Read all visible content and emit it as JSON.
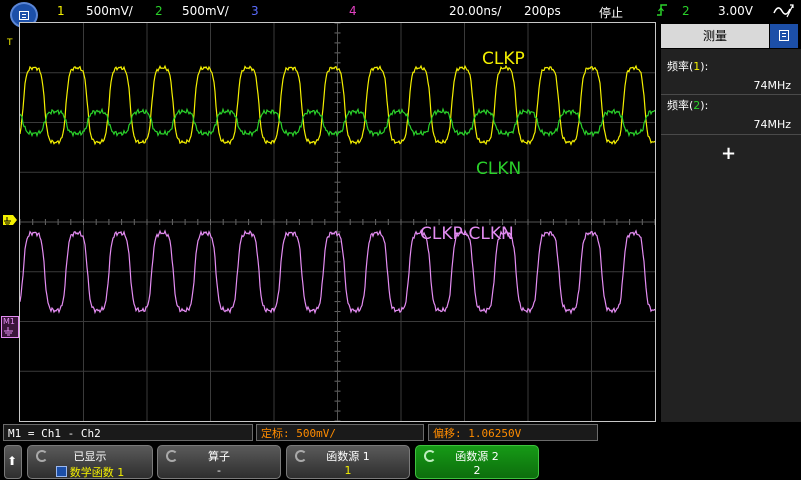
{
  "colors": {
    "ch1": "#f4f000",
    "ch2": "#2ad12a",
    "ch3": "#5a6cff",
    "ch4": "#e040c0",
    "math": "#e48cf2",
    "trigger": "#ff8c00",
    "active_key": "#169a16"
  },
  "topbar": {
    "ch1_num": "1",
    "ch1_scale": "500mV/",
    "ch2_num": "2",
    "ch2_scale": "500mV/",
    "ch3_num": "3",
    "ch4_num": "4",
    "timebase": "20.00ns/",
    "delay": "200ps",
    "run_state": "停止",
    "trig_icon": "rising-edge-trigger-icon",
    "trig_source": "2",
    "trig_level": "3.00V",
    "wave_icon": "waveform-symbol-icon"
  },
  "waveform_labels": {
    "clkp": "CLKP",
    "clkn": "CLKN",
    "math": "CLKP-CLKN"
  },
  "markers": {
    "trigger_T": "T",
    "ch1_marker": "1",
    "math_marker": "M1"
  },
  "measure": {
    "title": "测量",
    "items": [
      {
        "label_prefix": "频率(",
        "channel": "1",
        "label_suffix": "):",
        "value": "74MHz"
      },
      {
        "label_prefix": "频率(",
        "channel": "2",
        "label_suffix": "):",
        "value": "74MHz"
      }
    ],
    "add_symbol": "+"
  },
  "status": {
    "math_def": "M1 = Ch1 - Ch2",
    "scale_label": "定标:",
    "scale_value": "500mV/",
    "offset_label": "偏移:",
    "offset_value": "1.06250V"
  },
  "softkeys": {
    "up_arrow": "⬆",
    "display": {
      "title": "已显示",
      "value": "数学函数 1"
    },
    "operator": {
      "title": "算子",
      "value": "-"
    },
    "source1": {
      "title": "函数源 1",
      "value": "1"
    },
    "source2": {
      "title": "函数源 2",
      "value": "2"
    }
  },
  "scope": {
    "period_ns": 13.5,
    "ch1_offset_div": 2.35,
    "ch2_offset_div": 2.0,
    "math_offset_div": -1.0
  }
}
